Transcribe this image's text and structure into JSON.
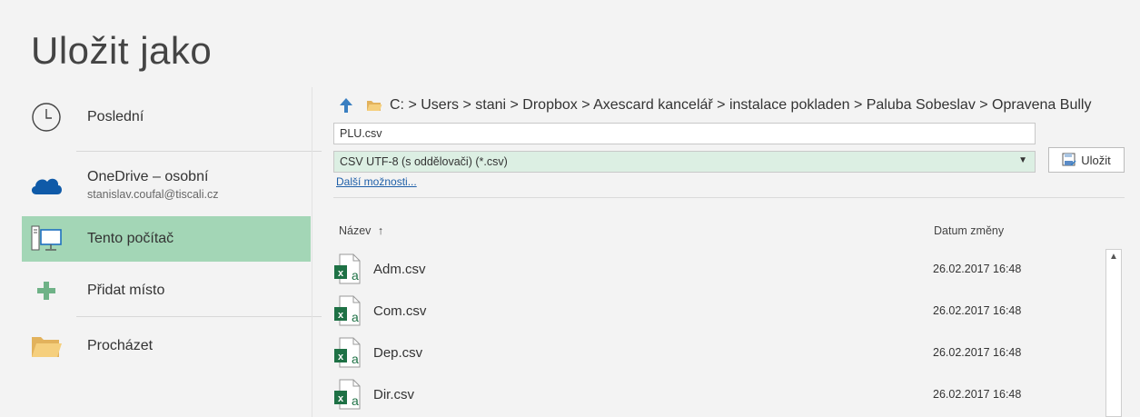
{
  "page_title": "Uložit jako",
  "nav": {
    "recent": "Poslední",
    "onedrive_title": "OneDrive – osobní",
    "onedrive_email": "stanislav.coufal@tiscali.cz",
    "this_pc": "Tento počítač",
    "add_place": "Přidat místo",
    "browse": "Procházet"
  },
  "path": {
    "drive": "C:",
    "segments": [
      "Users",
      "stani",
      "Dropbox",
      "Axescard kancelář",
      "instalace pokladen",
      "Paluba Sobeslav",
      "Opravena Bully"
    ],
    "separator": ">"
  },
  "filename_value": "PLU.csv",
  "filetype_selected": "CSV UTF-8 (s oddělovači) (*.csv)",
  "save_label": "Uložit",
  "more_options": "Další možnosti...",
  "columns": {
    "name": "Název",
    "sort_indicator": "↑",
    "date": "Datum změny"
  },
  "files": [
    {
      "name": "Adm.csv",
      "date": "26.02.2017 16:48"
    },
    {
      "name": "Com.csv",
      "date": "26.02.2017 16:48"
    },
    {
      "name": "Dep.csv",
      "date": "26.02.2017 16:48"
    },
    {
      "name": "Dir.csv",
      "date": "26.02.2017 16:48"
    }
  ],
  "colors": {
    "accent_green": "#a3d6b6",
    "excel_green": "#1e7145",
    "up_arrow_blue": "#3a7fc1",
    "link_blue": "#1e5fa8"
  }
}
